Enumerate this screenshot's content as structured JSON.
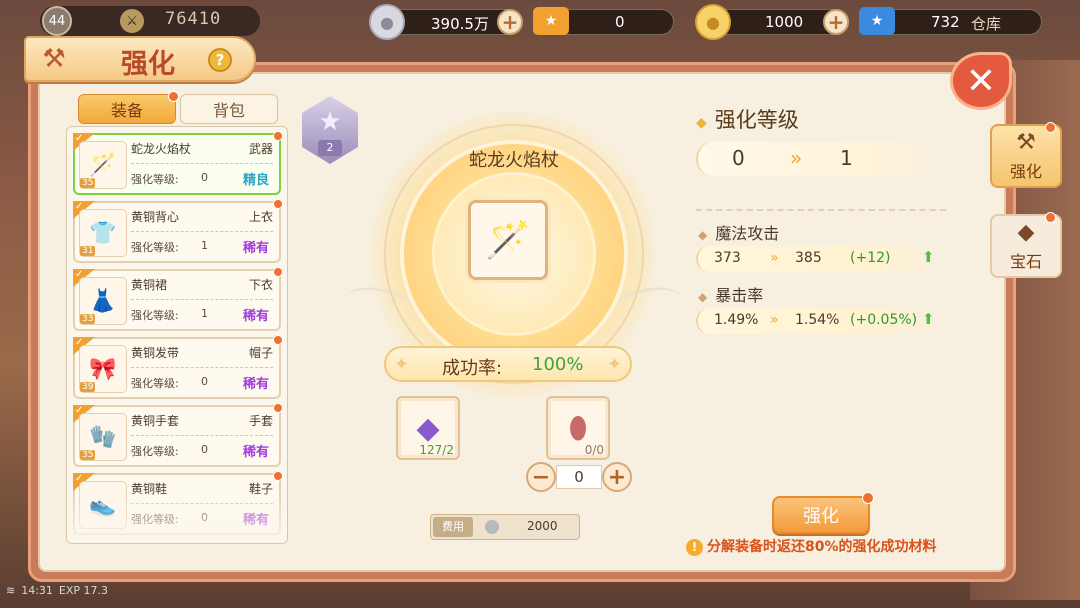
{
  "topbar": {
    "level": "44",
    "power": "76410",
    "silver": "390.5万",
    "ticket1": "0",
    "gold": "1000",
    "ticket2": "732",
    "warehouse_label": "仓库"
  },
  "panel": {
    "title": "强化",
    "help_glyph": "?",
    "close_glyph": "✕"
  },
  "tabs": {
    "equip": "装备",
    "bag": "背包"
  },
  "list": {
    "level_label": "强化等级:",
    "items": [
      {
        "name": "蛇龙火焰杖",
        "slot": "武器",
        "level": "0",
        "quality": "精良",
        "item_lv": "35",
        "icon": "🪄"
      },
      {
        "name": "黄铜背心",
        "slot": "上衣",
        "level": "1",
        "quality": "稀有",
        "item_lv": "31",
        "icon": "👕"
      },
      {
        "name": "黄铜裙",
        "slot": "下衣",
        "level": "1",
        "quality": "稀有",
        "item_lv": "33",
        "icon": "👗"
      },
      {
        "name": "黄铜发带",
        "slot": "帽子",
        "level": "0",
        "quality": "稀有",
        "item_lv": "39",
        "icon": "🎀"
      },
      {
        "name": "黄铜手套",
        "slot": "手套",
        "level": "0",
        "quality": "稀有",
        "item_lv": "35",
        "icon": "🧤"
      },
      {
        "name": "黄铜鞋",
        "slot": "鞋子",
        "level": "0",
        "quality": "稀有",
        "item_lv": "",
        "icon": "👟"
      }
    ]
  },
  "center": {
    "badge_num": "2",
    "item_name": "蛇龙火焰杖",
    "success_label": "成功率:",
    "success_val": "100%",
    "mat1_count": "127/2",
    "mat2_count": "0/0",
    "qty": "0",
    "cost_label": "费用",
    "cost": "2000"
  },
  "info": {
    "heading": "强化等级",
    "from_level": "0",
    "to_level": "1",
    "stats": [
      {
        "name": "魔法攻击",
        "old": "373",
        "new": "385",
        "gain": "(+12)"
      },
      {
        "name": "暴击率",
        "old": "1.49%",
        "new": "1.54%",
        "gain": "(+0.05%)"
      }
    ],
    "button": "强化",
    "tip": "分解装备时返还80%的强化成功材料"
  },
  "side": {
    "tab1": "强化",
    "tab2": "宝石"
  },
  "status": {
    "time": "14:31",
    "exp": "EXP 17.3"
  }
}
